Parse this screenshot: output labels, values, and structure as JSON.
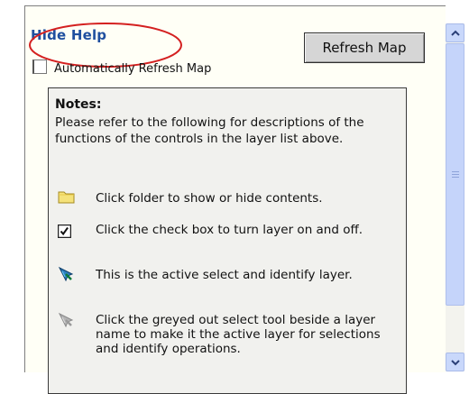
{
  "help": {
    "toggle_label": "Hide Help",
    "refresh_button_label": "Refresh Map",
    "auto_refresh_label": "Automatically Refresh Map",
    "auto_refresh_checked": false
  },
  "notes": {
    "heading": "Notes:",
    "intro": "Please refer to the following for descriptions of the functions of the controls in the layer list above.",
    "entries": [
      {
        "icon": "folder-icon",
        "text": "Click folder to show or hide contents."
      },
      {
        "icon": "checkbox-checked-icon",
        "text": "Click the check box to turn layer on and off."
      },
      {
        "icon": "active-select-tool-icon",
        "text": "This is the active select and identify layer."
      },
      {
        "icon": "greyed-select-tool-icon",
        "text": "Click the greyed out select tool beside a layer name to make it the active layer for selections and identify operations."
      }
    ]
  },
  "colors": {
    "link_blue": "#1f4f9f",
    "annotation_red": "#d42020",
    "scrollbar_blue": "#c5d4fa"
  }
}
